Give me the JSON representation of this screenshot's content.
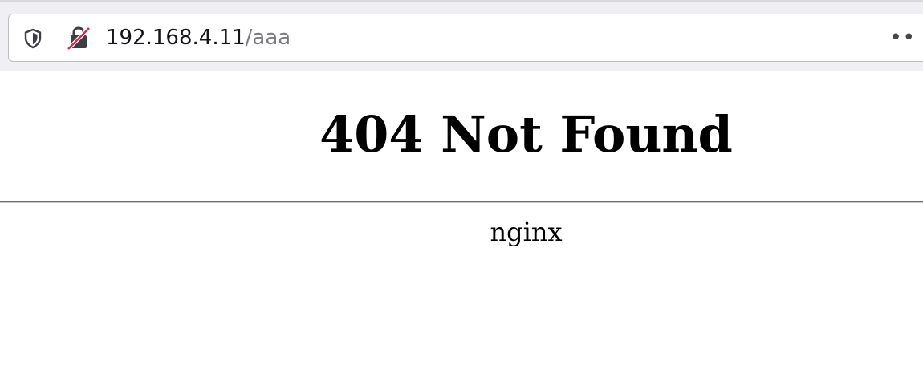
{
  "browser": {
    "url": {
      "host": "192.168.4.11",
      "path": "/aaa"
    },
    "icons": {
      "tracking_protection": "shield-icon",
      "connection": "insecure-lock-icon",
      "overflow": "more-icon"
    },
    "overflow_label": "••"
  },
  "page": {
    "heading": "404 Not Found",
    "server_name": "nginx"
  },
  "colors": {
    "toolbar_background": "#f0f0f4",
    "insecure_strike": "#e22850",
    "text": "#000000",
    "url_path": "#7a7a80"
  }
}
